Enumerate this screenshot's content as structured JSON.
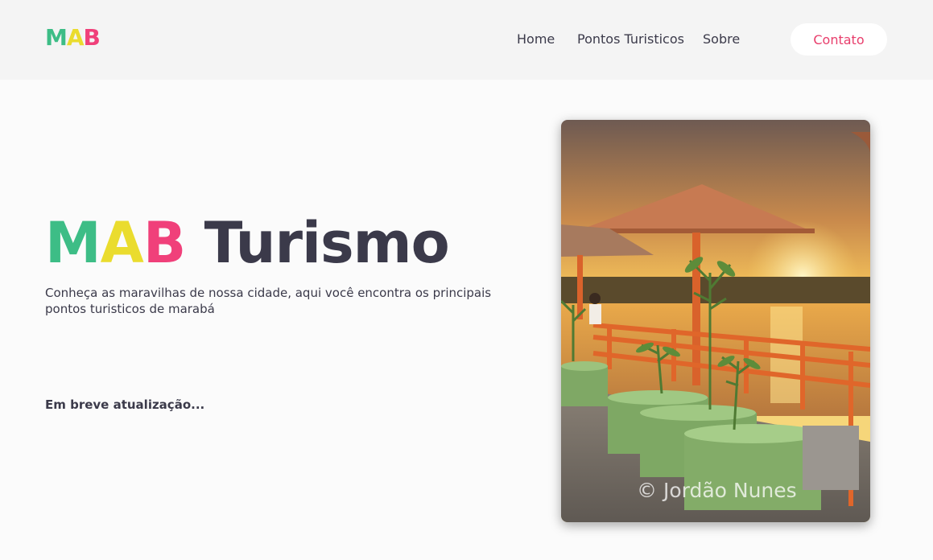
{
  "header": {
    "logo": {
      "letters": [
        "M",
        "A",
        "B"
      ],
      "colors": [
        "#3dbd86",
        "#f0e03a",
        "#f0407a"
      ]
    },
    "nav": {
      "home": "Home",
      "pontos": "Pontos Turisticos",
      "sobre": "Sobre"
    },
    "contact_label": "Contato"
  },
  "hero": {
    "title_letters": [
      "M",
      "A",
      "B"
    ],
    "title_word": "Turismo",
    "subtitle": "Conheça as maravilhas de nossa cidade, aqui você encontra os principais pontos turisticos de marabá",
    "update_note": "Em breve atualização..."
  },
  "photo": {
    "watermark": "© Jordão Nunes"
  },
  "colors": {
    "accent": "#e83e6c",
    "text": "#3b3a4a",
    "header_bg": "#f4f4f4"
  }
}
